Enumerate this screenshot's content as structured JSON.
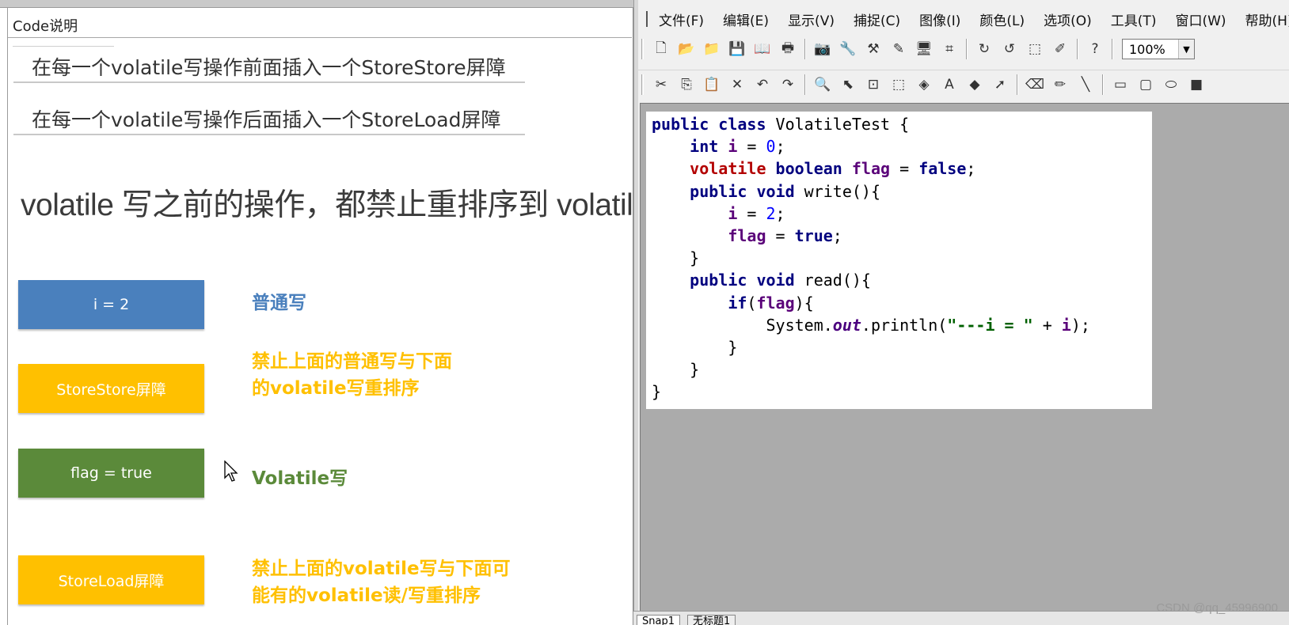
{
  "left_panel": {
    "title": "Code说明",
    "rules": [
      "在每一个volatile写操作前面插入一个StoreStore屏障",
      "在每一个volatile写操作后面插入一个StoreLoad屏障"
    ],
    "heading": "volatile 写之前的操作，都禁止重排序到 volatile 之后",
    "steps": [
      {
        "box_label": "i = 2",
        "box_color": "#4a80bd",
        "desc": [
          "普通写"
        ],
        "desc_color": "#4a80bd"
      },
      {
        "box_label": "StoreStore屏障",
        "box_color": "#ffc000",
        "desc": [
          "禁止上面的普通写与下面",
          "的volatile写重排序"
        ],
        "desc_color": "#ffc000"
      },
      {
        "box_label": "flag = true",
        "box_color": "#5b8a3a",
        "desc": [
          "Volatile写"
        ],
        "desc_color": "#5b8a3a"
      },
      {
        "box_label": "StoreLoad屏障",
        "box_color": "#ffc000",
        "desc": [
          "禁止上面的volatile写与下面可",
          "能有的volatile读/写重排序"
        ],
        "desc_color": "#ffc000"
      }
    ]
  },
  "app": {
    "menu": [
      "文件(F)",
      "编辑(E)",
      "显示(V)",
      "捕捉(C)",
      "图像(I)",
      "颜色(L)",
      "选项(O)",
      "工具(T)",
      "窗口(W)",
      "帮助(H)"
    ],
    "zoom": "100%",
    "toolbar1_icons": [
      "new-file-icon",
      "open-folder-icon",
      "open-recent-icon",
      "save-icon",
      "book-icon",
      "print-icon",
      "camera-icon",
      "wrench-icon",
      "tools-icon",
      "edit-icon",
      "screen-icon",
      "scan-icon",
      "rotate-icon",
      "undo-rotate-icon",
      "capture-icon",
      "pen-tool-icon",
      "help-icon"
    ],
    "toolbar1_glyphs": [
      "🗋",
      "📂",
      "📁",
      "💾",
      "📖",
      "🖶",
      "📷",
      "🔧",
      "⚒",
      "✎",
      "🖥",
      "⌗",
      "↻",
      "↺",
      "⬚",
      "✐",
      "?"
    ],
    "toolbar2_icons": [
      "cut-icon",
      "copy-icon",
      "paste-icon",
      "delete-icon",
      "undo-icon",
      "redo-icon",
      "zoom-icon",
      "select-arrow-icon",
      "crop-icon",
      "rect-select-icon",
      "fill-icon",
      "text-icon",
      "color-picker-icon",
      "arrow-tool-icon",
      "eraser-icon",
      "pencil-icon",
      "line-icon",
      "rectangle-icon",
      "rounded-rect-icon",
      "ellipse-icon",
      "filled-rect-icon"
    ],
    "toolbar2_glyphs": [
      "✂",
      "⎘",
      "📋",
      "✕",
      "↶",
      "↷",
      "🔍",
      "⬉",
      "⊡",
      "⬚",
      "◈",
      "A",
      "◆",
      "➚",
      "⌫",
      "✏",
      "╲",
      "▭",
      "▢",
      "⬭",
      "■"
    ],
    "tabs": [
      "Snap1",
      "无标题1"
    ],
    "watermark": "CSDN @qq_45996900"
  },
  "code_lines": [
    "public class VolatileTest {",
    "    int i = 0;",
    "    volatile boolean flag = false;",
    "    public void write(){",
    "        i = 2;",
    "        flag = true;",
    "    }",
    "    public void read(){",
    "        if(flag){",
    "            System.out.println(\"---i = \" + i);",
    "        }",
    "    }",
    "}"
  ]
}
